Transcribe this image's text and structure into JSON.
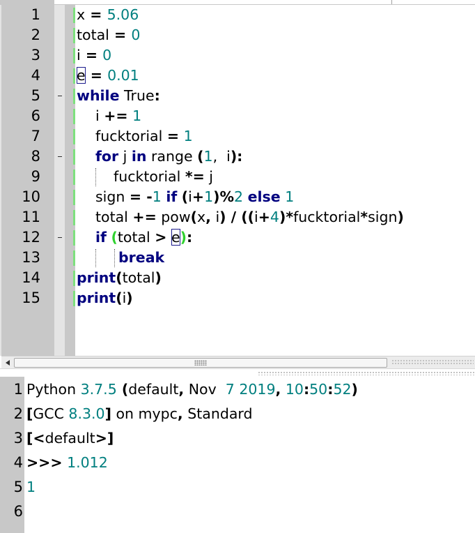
{
  "editor": {
    "line_numbers": [
      "1",
      "2",
      "3",
      "4",
      "5",
      "6",
      "7",
      "8",
      "9",
      "10",
      "11",
      "12",
      "13",
      "14",
      "15"
    ],
    "lines": {
      "l1": {
        "a": "x",
        "b": " = ",
        "c": "5.06"
      },
      "l2": {
        "a": "total",
        "b": " = ",
        "c": "0"
      },
      "l3": {
        "a": "i",
        "b": " = ",
        "c": "0"
      },
      "l4": {
        "a": "e",
        "b": " = ",
        "c": "0.01"
      },
      "l5": {
        "kw": "while",
        "a": " True",
        "b": ":"
      },
      "l6": {
        "a": "i ",
        "b": "+=",
        "c": " ",
        "d": "1"
      },
      "l7": {
        "a": "fucktorial ",
        "b": "=",
        "c": " ",
        "d": "1"
      },
      "l8": {
        "kw1": "for",
        "a": " j ",
        "kw2": "in",
        "b": " range ",
        "c": "(",
        "d": "1",
        "e": ",  i",
        "f": "):"
      },
      "l9": {
        "a": "fucktorial ",
        "b": "*=",
        "c": " j"
      },
      "l10": {
        "a": "sign ",
        "b": "= -",
        "c": "1",
        "d": " ",
        "kw1": "if",
        "e": " ",
        "f": "(",
        "g": "i",
        "h": "+",
        "i": "1",
        "j": ")%",
        "k": "2",
        "l": " ",
        "kw2": "else",
        "m": " ",
        "n": "1"
      },
      "l11": {
        "a": "total ",
        "b": "+=",
        "c": " pow",
        "d": "(",
        "e": "x",
        "f": ",",
        "g": " i",
        "h": ")",
        "i": " / ",
        "j": "((",
        "k": "i",
        "l": "+",
        "m": "4",
        "n": ")*",
        "o": "fucktorial",
        "p": "*",
        "q": "sign",
        "r": ")"
      },
      "l12": {
        "kw": "if",
        "a": " ",
        "b": "(",
        "c": "total ",
        "d": ">",
        "e": " ",
        "f": "e",
        "g": ")",
        "h": ":"
      },
      "l13": {
        "kw": "break"
      },
      "l14": {
        "kw": "print",
        "a": "(",
        "b": "total",
        "c": ")"
      },
      "l15": {
        "kw": "print",
        "a": "(",
        "b": "i",
        "c": ")"
      }
    }
  },
  "shell": {
    "line_numbers": [
      "1",
      "2",
      "3",
      "4",
      "5",
      "6"
    ],
    "l1": {
      "a": "Python ",
      "b": "3.7.5",
      "c": " (",
      "d": "default",
      "e": ",",
      "f": " Nov  ",
      "g": "7",
      "h": " ",
      "i": "2019",
      "j": ",",
      "k": " ",
      "l": "10",
      "m": ":",
      "n": "50",
      "o": ":",
      "p": "52",
      "q": ")"
    },
    "l2": {
      "a": "[",
      "b": "GCC ",
      "c": "8.3.0",
      "d": "]",
      "e": " on mypc",
      "f": ",",
      "g": " Standard"
    },
    "l3": {
      "a": "[<",
      "b": "default",
      "c": ">]"
    },
    "l4": {
      "a": ">>>",
      "b": " ",
      "c": "1.012"
    },
    "l5": {
      "a": "1"
    },
    "l6": {
      "a": ""
    }
  },
  "colors": {
    "keyword": "#00007f",
    "number": "#007f7f",
    "gutter": "#c8c8c8",
    "change_marker": "#7ee07e",
    "brace_match": "#2fd12f"
  }
}
